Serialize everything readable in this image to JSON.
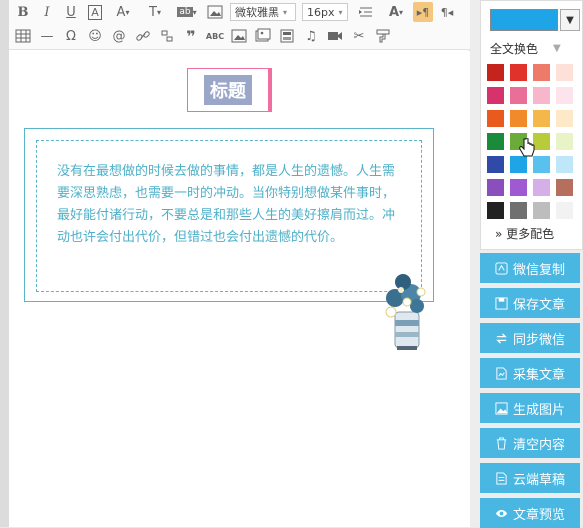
{
  "toolbar": {
    "font_family": "微软雅黑",
    "font_size": "16px",
    "row1_icons": [
      "bold-icon",
      "italic-icon",
      "underline-icon",
      "font-border-icon",
      "font-color-icon",
      "text-bg-icon",
      "table-style-icon",
      "image-icon"
    ],
    "row2_icons": [
      "table-icon",
      "horizontal-rule-icon",
      "omega-icon",
      "emoji-icon",
      "at-icon",
      "link-icon",
      "unlink-icon",
      "quote-icon",
      "spellcheck-icon",
      "image-icon",
      "image-gallery-icon",
      "template-icon",
      "music-icon",
      "video-icon",
      "cut-icon",
      "format-paint-icon"
    ]
  },
  "editor": {
    "title": "标题",
    "quote_text": "没有在最想做的时候去做的事情，都是人生的遗憾。人生需要深思熟虑，也需要一时的冲动。当你特别想做某件事时，最好能付诸行动，不要总是和那些人生的美好擦肩而过。冲动也许会付出代价，但错过也会付出遗憾的代价。"
  },
  "palette": {
    "current_color": "#1fa4e8",
    "whole_color_label": "全文换色",
    "more_colors_label": "更多配色",
    "swatches": [
      [
        "#c4241c",
        "#e0312b",
        "#ee7a6a",
        "#fde0d7"
      ],
      [
        "#d7326c",
        "#ea6f98",
        "#f7b6cb",
        "#fde4ec"
      ],
      [
        "#e85a1e",
        "#f08a2a",
        "#f5b74a",
        "#fde9c8"
      ],
      [
        "#1a8a3b",
        "#6aab39",
        "#b8cc3b",
        "#e8f3c8"
      ],
      [
        "#2f4ba7",
        "#1fa4e8",
        "#58c1ee",
        "#bfe7fa"
      ],
      [
        "#8a4fbd",
        "#a05ad1",
        "#d6aee8",
        "#b56f5c"
      ],
      [
        "#222222",
        "#707070",
        "#bdbdbd",
        "#f2f2f2"
      ]
    ]
  },
  "actions": [
    {
      "label": "微信复制",
      "icon": "copy-icon"
    },
    {
      "label": "保存文章",
      "icon": "save-icon"
    },
    {
      "label": "同步微信",
      "icon": "sync-icon"
    },
    {
      "label": "采集文章",
      "icon": "collect-icon"
    },
    {
      "label": "生成图片",
      "icon": "image-icon"
    },
    {
      "label": "清空内容",
      "icon": "trash-icon"
    },
    {
      "label": "云端草稿",
      "icon": "cloud-draft-icon"
    },
    {
      "label": "文章预览",
      "icon": "eye-icon"
    }
  ]
}
